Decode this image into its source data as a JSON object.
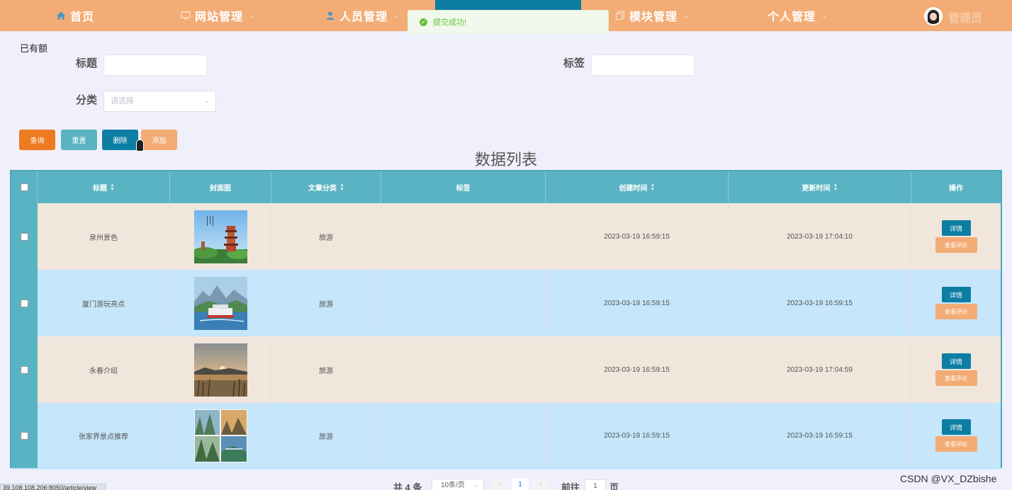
{
  "nav": {
    "items": [
      {
        "label": "首页",
        "icon": "home-icon"
      },
      {
        "label": "网站管理",
        "icon": "monitor-icon"
      },
      {
        "label": "人员管理",
        "icon": "user-icon"
      },
      {
        "label": "模块管理",
        "icon": "copy-icon"
      },
      {
        "label": "个人管理",
        "icon": ""
      }
    ],
    "admin_label": "管理员",
    "colors": {
      "bar": "#f3ac75",
      "active": "#0d7ea3"
    }
  },
  "toast": {
    "message": "提交成功!",
    "icon": "check-circle-icon"
  },
  "breadcrumb": "已有额",
  "form": {
    "title_label": "标题",
    "tag_label": "标签",
    "category_label": "分类",
    "category_placeholder": "请选择"
  },
  "buttons": {
    "query": "查询",
    "reset": "重置",
    "delete": "删除",
    "add": "添加"
  },
  "table": {
    "title": "数据列表",
    "columns": [
      "标题",
      "封面图",
      "文章分类",
      "标签",
      "创建时间",
      "更新时间",
      "操作"
    ],
    "rows": [
      {
        "title": "泉州景色",
        "category": "旅游",
        "tag": "",
        "created": "2023-03-19 16:59:15",
        "updated": "2023-03-19 17:04:10",
        "cover": "pagoda-image"
      },
      {
        "title": "厦门游玩亮点",
        "category": "旅游",
        "tag": "",
        "created": "2023-03-19 16:59:15",
        "updated": "2023-03-19 16:59:15",
        "cover": "ferry-image"
      },
      {
        "title": "永春介绍",
        "category": "旅游",
        "tag": "",
        "created": "2023-03-19 16:59:15",
        "updated": "2023-03-19 17:04:59",
        "cover": "sunset-lake-image"
      },
      {
        "title": "张家界景点推荐",
        "category": "旅游",
        "tag": "",
        "created": "2023-03-19 16:59:15",
        "updated": "2023-03-19 16:59:15",
        "cover": "mountain-collage-image"
      }
    ],
    "detail_label": "详情",
    "review_label": "查看评论",
    "row_colors": [
      "#f1e6dc",
      "#c5e6fb"
    ]
  },
  "pagination": {
    "total": "共 4 条",
    "page_size": "10条/页",
    "prev": "‹",
    "current": "1",
    "next": "›",
    "goto_label": "前往",
    "goto_value": "1",
    "page_label": "页"
  },
  "status_url": "39.108.108.206:8050/article/view",
  "watermark": "CSDN @VX_DZbishe"
}
